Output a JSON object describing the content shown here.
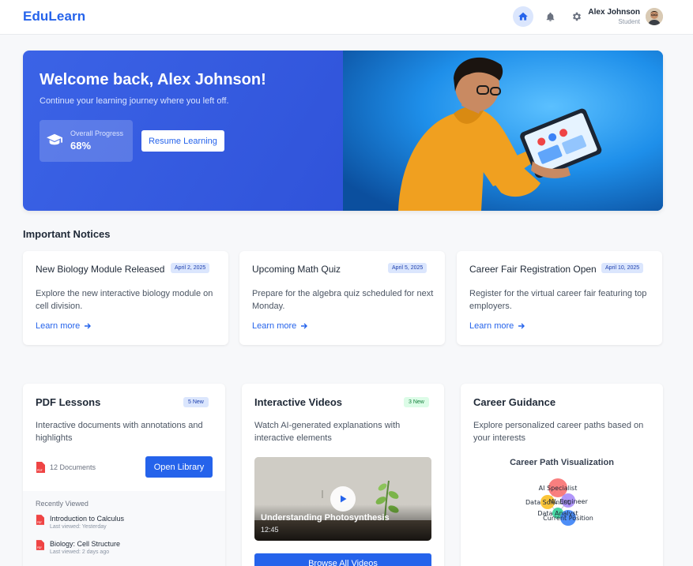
{
  "header": {
    "brand": "EduLearn",
    "user_name": "Alex Johnson",
    "user_role": "Student",
    "accent": "#2563eb"
  },
  "hero": {
    "title": "Welcome back, Alex Johnson!",
    "subtitle": "Continue your learning journey where you left off.",
    "progress_label": "Overall Progress",
    "progress_value": "68%",
    "resume_label": "Resume Learning"
  },
  "notices": {
    "section_title": "Important Notices",
    "items": [
      {
        "title": "New Biology Module Released",
        "date": "April 2, 2025",
        "desc": "Explore the new interactive biology module on cell division.",
        "link": "Learn more"
      },
      {
        "title": "Upcoming Math Quiz",
        "date": "April 5, 2025",
        "desc": "Prepare for the algebra quiz scheduled for next Monday.",
        "link": "Learn more"
      },
      {
        "title": "Career Fair Registration Open",
        "date": "April 10, 2025",
        "desc": "Register for the virtual career fair featuring top employers.",
        "link": "Learn more"
      }
    ]
  },
  "pdf": {
    "title": "PDF Lessons",
    "badge": "5 New",
    "desc": "Interactive documents with annotations and highlights",
    "doc_count": "12 Documents",
    "open_label": "Open Library",
    "recent_title": "Recently Viewed",
    "recent": [
      {
        "name": "Introduction to Calculus",
        "time": "Last viewed: Yesterday"
      },
      {
        "name": "Biology: Cell Structure",
        "time": "Last viewed: 2 days ago"
      }
    ]
  },
  "videos": {
    "title": "Interactive Videos",
    "badge": "3 New",
    "desc": "Watch AI-generated explanations with interactive elements",
    "video_title": "Understanding Photosynthesis",
    "video_time": "12:45",
    "browse_label": "Browse All Videos"
  },
  "career": {
    "title": "Career Guidance",
    "desc": "Explore personalized career paths based on your interests",
    "viz_title": "Career Path Visualization",
    "nodes": [
      {
        "label": "AI Specialist",
        "color": "#f87171"
      },
      {
        "label": "Data Scientist",
        "color": "#fbbf24"
      },
      {
        "label": "ML Engineer",
        "color": "#a78bfa"
      },
      {
        "label": "Data Analyst",
        "color": "#34d399"
      },
      {
        "label": "Current Position",
        "color": "#3b82f6"
      }
    ]
  }
}
